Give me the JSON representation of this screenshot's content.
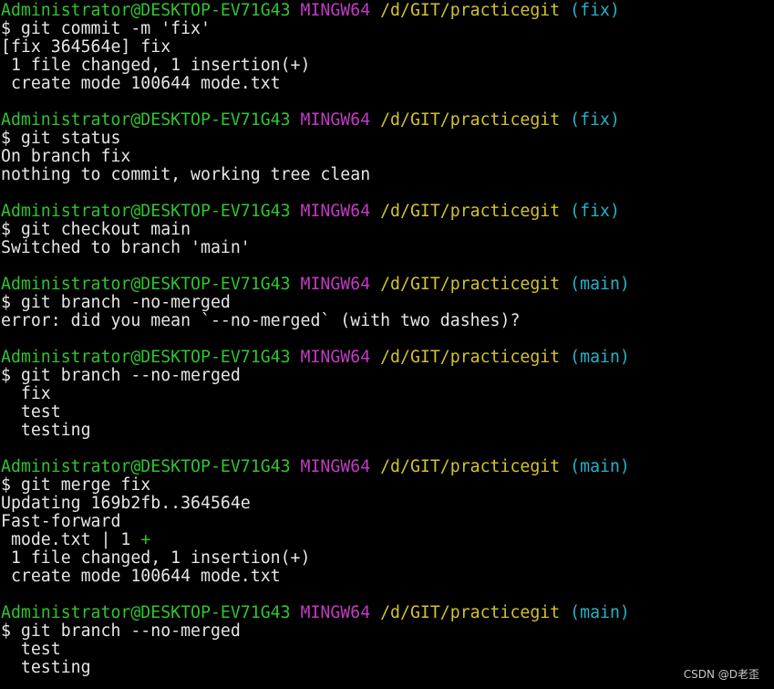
{
  "terminal": {
    "lines": [
      {
        "type": "prompt",
        "user": "Administrator@DESKTOP-EV71G43",
        "mingw": "MINGW64",
        "path": "/d/GIT/practicegit",
        "branch": "(fix)"
      },
      {
        "type": "command",
        "text": "$ git commit -m 'fix'"
      },
      {
        "type": "output",
        "text": "[fix 364564e] fix"
      },
      {
        "type": "output",
        "text": " 1 file changed, 1 insertion(+)"
      },
      {
        "type": "output",
        "text": " create mode 100644 mode.txt"
      },
      {
        "type": "blank",
        "text": ""
      },
      {
        "type": "prompt",
        "user": "Administrator@DESKTOP-EV71G43",
        "mingw": "MINGW64",
        "path": "/d/GIT/practicegit",
        "branch": "(fix)"
      },
      {
        "type": "command",
        "text": "$ git status"
      },
      {
        "type": "output",
        "text": "On branch fix"
      },
      {
        "type": "output",
        "text": "nothing to commit, working tree clean"
      },
      {
        "type": "blank",
        "text": ""
      },
      {
        "type": "prompt",
        "user": "Administrator@DESKTOP-EV71G43",
        "mingw": "MINGW64",
        "path": "/d/GIT/practicegit",
        "branch": "(fix)"
      },
      {
        "type": "command",
        "text": "$ git checkout main"
      },
      {
        "type": "output",
        "text": "Switched to branch 'main'"
      },
      {
        "type": "blank",
        "text": ""
      },
      {
        "type": "prompt",
        "user": "Administrator@DESKTOP-EV71G43",
        "mingw": "MINGW64",
        "path": "/d/GIT/practicegit",
        "branch": "(main)"
      },
      {
        "type": "command",
        "text": "$ git branch -no-merged"
      },
      {
        "type": "output",
        "text": "error: did you mean `--no-merged` (with two dashes)?"
      },
      {
        "type": "blank",
        "text": ""
      },
      {
        "type": "prompt",
        "user": "Administrator@DESKTOP-EV71G43",
        "mingw": "MINGW64",
        "path": "/d/GIT/practicegit",
        "branch": "(main)"
      },
      {
        "type": "command",
        "text": "$ git branch --no-merged"
      },
      {
        "type": "output",
        "text": "  fix"
      },
      {
        "type": "output",
        "text": "  test"
      },
      {
        "type": "output",
        "text": "  testing"
      },
      {
        "type": "blank",
        "text": ""
      },
      {
        "type": "prompt",
        "user": "Administrator@DESKTOP-EV71G43",
        "mingw": "MINGW64",
        "path": "/d/GIT/practicegit",
        "branch": "(main)"
      },
      {
        "type": "command",
        "text": "$ git merge fix"
      },
      {
        "type": "output",
        "text": "Updating 169b2fb..364564e"
      },
      {
        "type": "output",
        "text": "Fast-forward"
      },
      {
        "type": "diffstat",
        "text": " mode.txt | 1 ",
        "plus": "+"
      },
      {
        "type": "output",
        "text": " 1 file changed, 1 insertion(+)"
      },
      {
        "type": "output",
        "text": " create mode 100644 mode.txt"
      },
      {
        "type": "blank",
        "text": ""
      },
      {
        "type": "prompt",
        "user": "Administrator@DESKTOP-EV71G43",
        "mingw": "MINGW64",
        "path": "/d/GIT/practicegit",
        "branch": "(main)"
      },
      {
        "type": "command",
        "text": "$ git branch --no-merged"
      },
      {
        "type": "output",
        "text": "  test"
      },
      {
        "type": "output",
        "text": "  testing"
      }
    ]
  },
  "watermark": "CSDN @D老歪",
  "colors": {
    "background": "#000000",
    "text": "#e6e6e6",
    "user": "#2ec52e",
    "mingw": "#c339c3",
    "path": "#d2c32a",
    "branch": "#25b3c9"
  }
}
